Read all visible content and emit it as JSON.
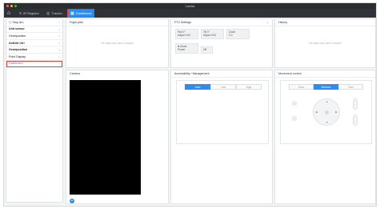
{
  "window": {
    "title": "Lavida"
  },
  "tabs": [
    {
      "label": "IR Register"
    },
    {
      "label": "Tracker"
    },
    {
      "label": "Dashboard"
    }
  ],
  "sidebar": {
    "items": [
      {
        "label": "▢ Stop ALL"
      },
      {
        "label": "Unit sensor"
      },
      {
        "label": "Gear/position"
      },
      {
        "label": "Airfield Ctrl"
      },
      {
        "label": "Gear/position"
      },
      {
        "label": "Point Display"
      },
      {
        "label": "Dashboard"
      }
    ]
  },
  "panels": {
    "flight_path": {
      "title": "Flight path",
      "empty": "No data has been loaded"
    },
    "ptz_settings": {
      "title": "PTZ Settings",
      "fields": [
        {
          "label": "Pan 0°",
          "value": "Adjust 0.00"
        },
        {
          "label": "Tilt 0°",
          "value": "Adjust 0.00"
        },
        {
          "label": "Zoom",
          "value": "1.0"
        }
      ],
      "mode_label": "✚ Mode",
      "mode_value": "Preset",
      "mode_extra": "Off"
    },
    "history": {
      "title": "History",
      "empty": "No data has been loaded"
    },
    "camera": {
      "title": "Camera"
    },
    "accessibility": {
      "title": "Accessibility / Management",
      "segments": [
        "Auto",
        "Low",
        "High"
      ]
    },
    "movement": {
      "title": "Movement control",
      "segments": [
        "Slow",
        "Medium",
        "Fast"
      ]
    }
  },
  "colors": {
    "accent": "#2d8cf0",
    "highlight": "#e2422f",
    "titlebar": "#2b2d31",
    "tabbar": "#2f3237"
  }
}
